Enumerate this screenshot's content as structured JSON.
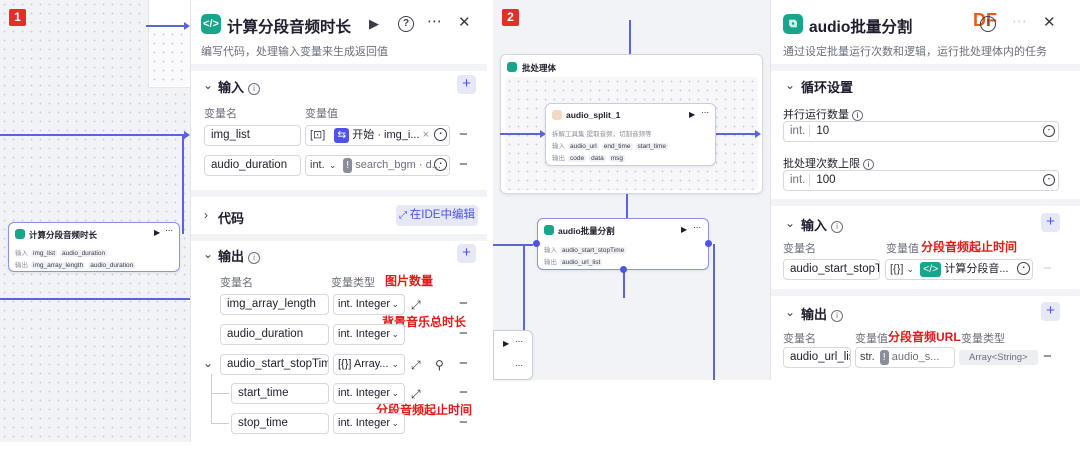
{
  "shot1": {
    "marker": "1",
    "panel": {
      "title": "计算分段音频时长",
      "description": "编写代码，处理输入变量来生成返回值",
      "input_section": "输入",
      "var_name_col": "变量名",
      "var_value_col": "变量值",
      "inputs": [
        {
          "name": "img_list",
          "type": "[⊡]",
          "ref": "开始 · img_i..."
        },
        {
          "name": "audio_duration",
          "type": "int.",
          "ref": "search_bgm · d..."
        }
      ],
      "code_section": "代码",
      "ide_button": "在IDE中编辑",
      "output_section": "输出",
      "output_name_col": "变量名",
      "output_type_col": "变量类型",
      "outputs": [
        {
          "name": "img_array_length",
          "type": "int. Integer"
        },
        {
          "name": "audio_duration",
          "type": "int. Integer"
        },
        {
          "name": "audio_start_stopTime",
          "type": "[{}] Array..."
        },
        {
          "name": "start_time",
          "type": "int. Integer"
        },
        {
          "name": "stop_time",
          "type": "int. Integer"
        }
      ],
      "annotations": [
        "图片数量",
        "背景音乐总时长",
        "分段音频起止时间"
      ]
    },
    "canvas_node": {
      "title": "计算分段音频时长",
      "input_label": "输入",
      "inputs": [
        "img_list",
        "audio_duration"
      ],
      "output_label": "输出",
      "outputs": [
        "img_array_length",
        "audio_duration"
      ]
    }
  },
  "shot2": {
    "marker": "2",
    "batch_container_title": "批处理体",
    "inner_node": {
      "title": "audio_split_1",
      "desc": "拆解工具集·提取音频，切割音频等",
      "input_label": "输入",
      "inputs": [
        "audio_url",
        "end_time",
        "start_time"
      ],
      "output_label": "输出",
      "outputs": [
        "code",
        "data",
        "msg"
      ]
    },
    "batch_node": {
      "title": "audio批量分割",
      "input_label": "输入",
      "input": "audio_start_stopTime",
      "output_label": "输出",
      "output": "audio_url_list"
    },
    "panel": {
      "title": "audio批量分割",
      "description": "通过设定批量运行次数和逻辑，运行批处理体内的任务",
      "loop_section": "循环设置",
      "parallel_label": "并行运行数量",
      "parallel_value": "10",
      "batch_limit_label": "批处理次数上限",
      "batch_limit_value": "100",
      "input_section": "输入",
      "var_name_col": "变量名",
      "var_value_col": "变量值",
      "input_name": "audio_start_stopTin",
      "input_type": "[{}]",
      "input_ref": "计算分段音...",
      "output_section": "输出",
      "out_name_col": "变量名",
      "out_value_col": "变量值",
      "out_type_col": "变量类型",
      "output_name": "audio_url_lis",
      "output_type": "str.",
      "output_ref": "audio_s...",
      "output_var_type": "Array<String>",
      "annotations": [
        "分段音频起止时间",
        "分段音频URL"
      ]
    },
    "watermark": "DF"
  }
}
